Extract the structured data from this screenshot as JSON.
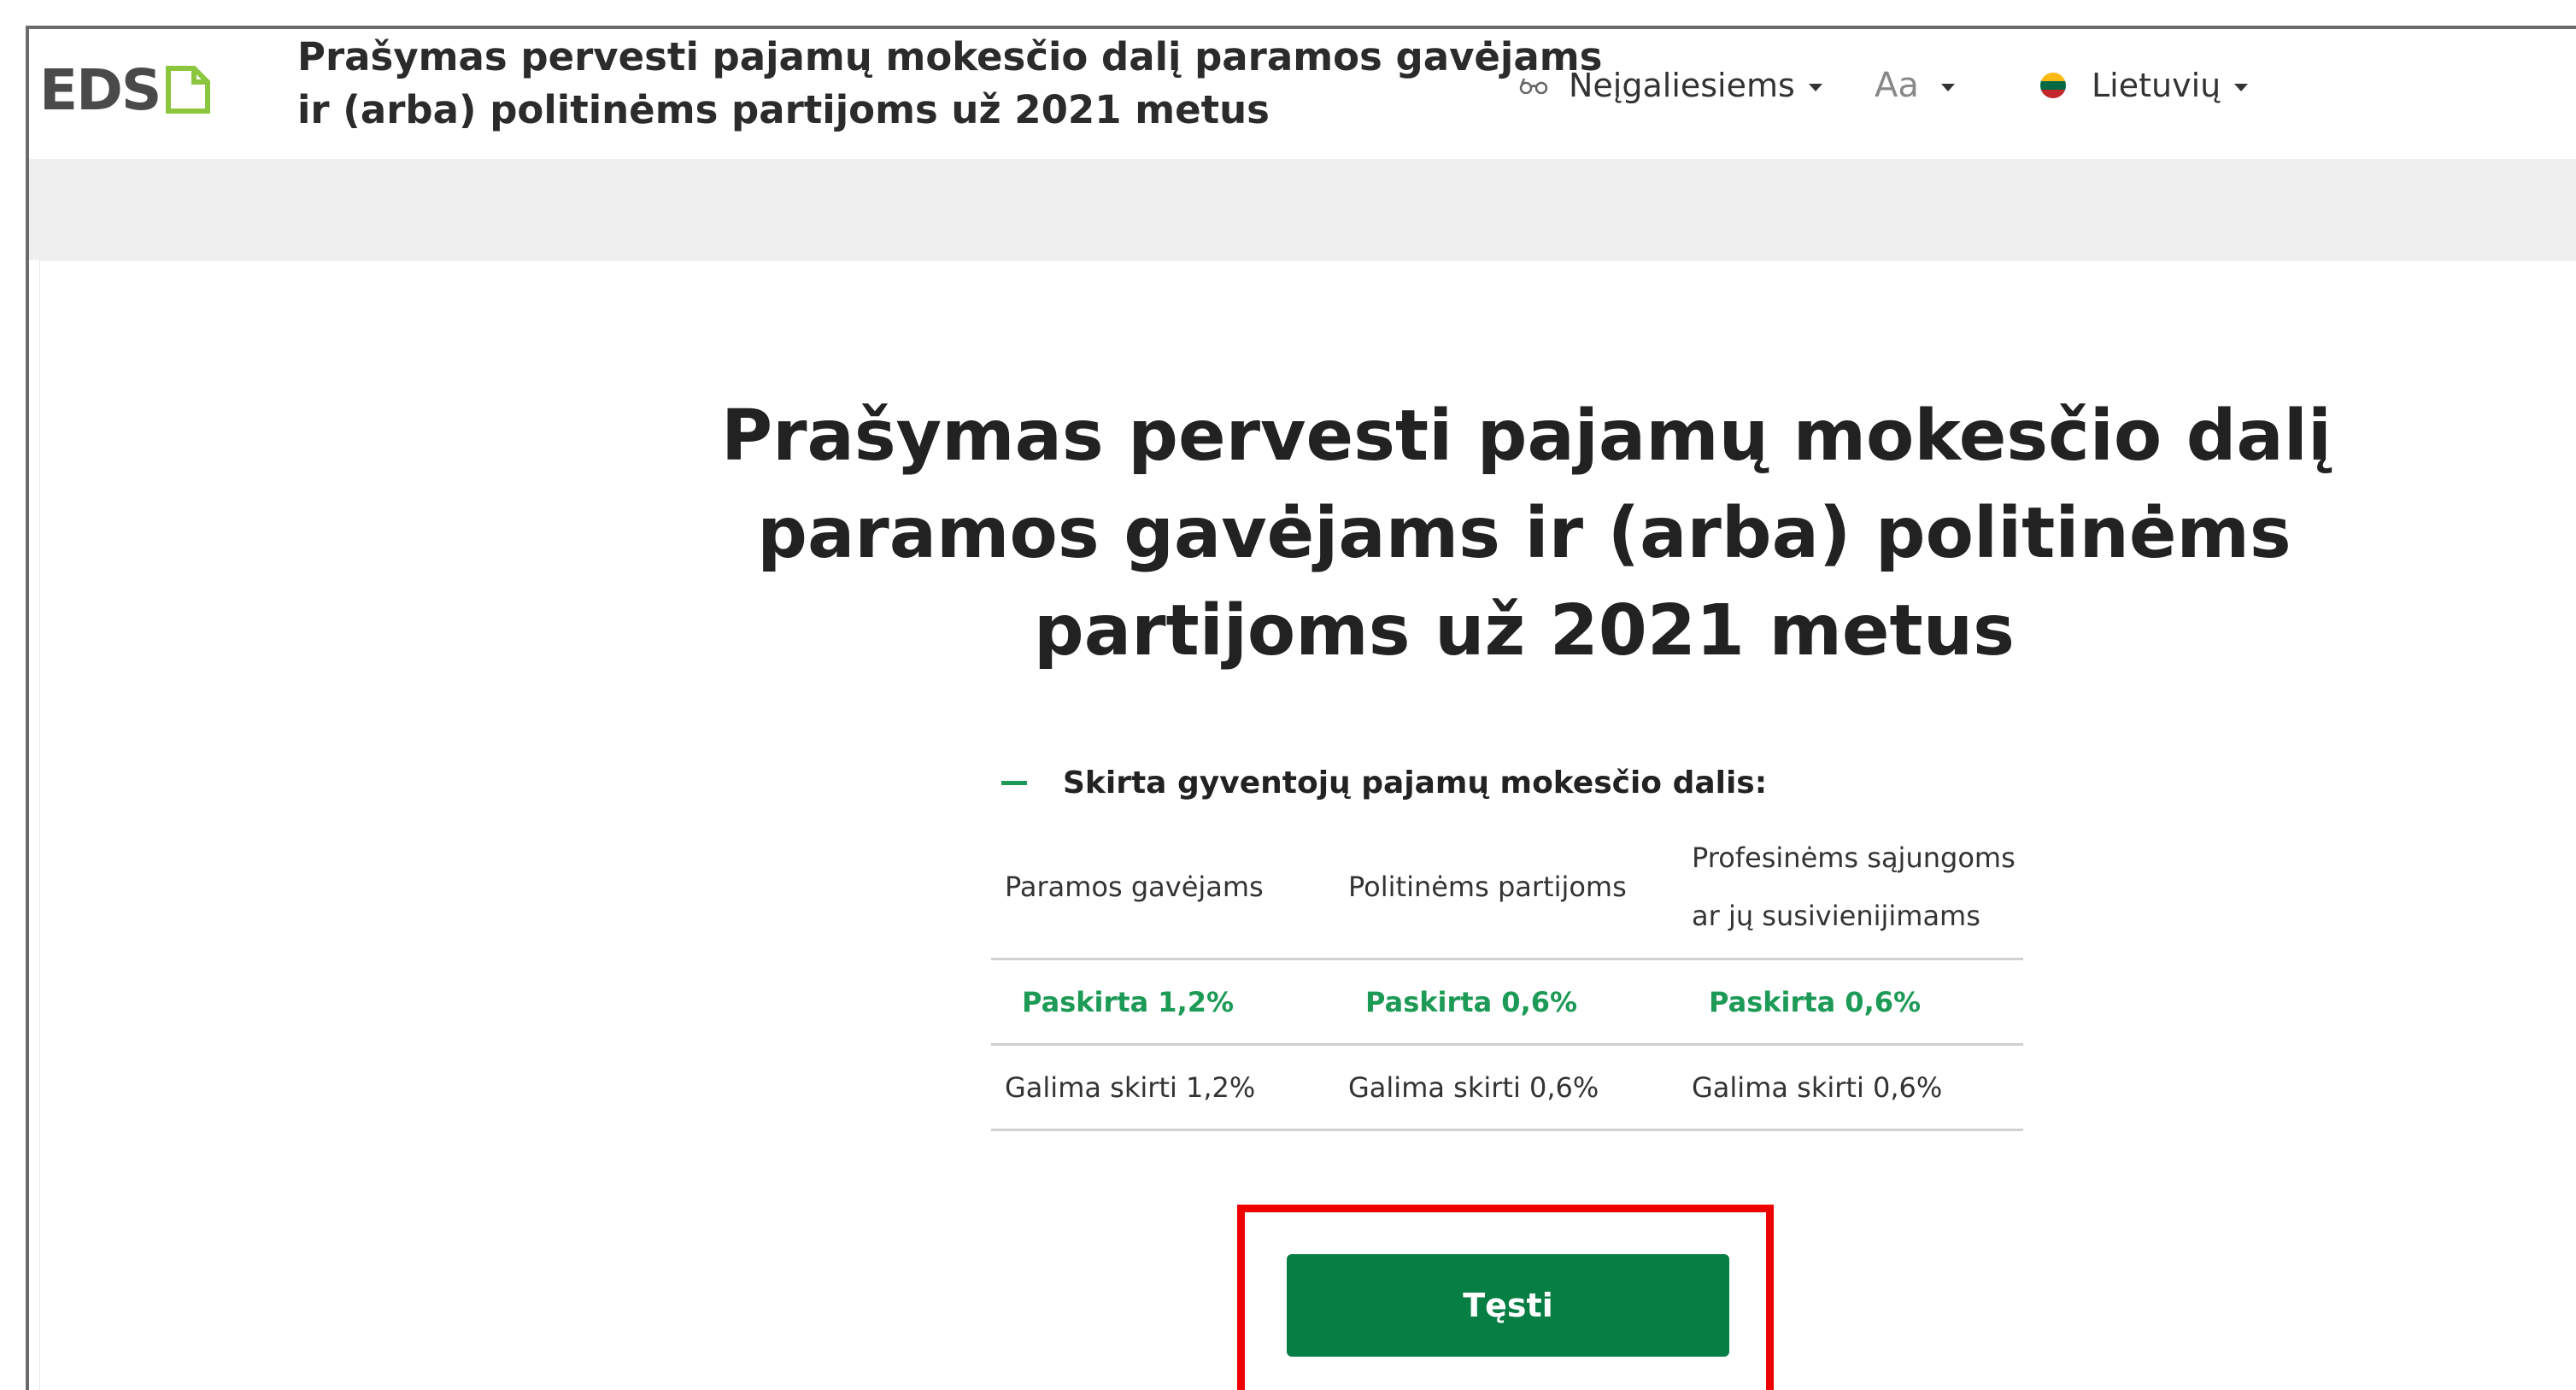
{
  "header": {
    "logo_text": "EDS",
    "title_lines": [
      "Prašymas pervesti pajamų mokesčio dalį paramos gavėjams",
      "ir (arba) politinėms partijoms už 2021 metus"
    ],
    "accessibility_label": "Neįgaliesiems",
    "font_size_label": "Aa",
    "language_label": "Lietuvių"
  },
  "main": {
    "title_lines": [
      "Prašymas pervesti pajamų mokesčio dalį",
      "paramos gavėjams ir (arba) politinėms",
      "partijoms už 2021 metus"
    ],
    "section_title": "Skirta gyventojų pajamų mokesčio dalis:",
    "table": {
      "headers": [
        [
          "Paramos gavėjams"
        ],
        [
          "Politinėms partijoms"
        ],
        [
          "Profesinėms sąjungoms",
          "ar jų susivienijimams"
        ]
      ],
      "allocated": [
        "Paskirta 1,2%",
        "Paskirta 0,6%",
        "Paskirta 0,6%"
      ],
      "available": [
        "Galima skirti 1,2%",
        "Galima skirti 0,6%",
        "Galima skirti 0,6%"
      ]
    },
    "continue_label": "Tęsti"
  },
  "colors": {
    "accent_green": "#1c9a56",
    "button_green": "#077e44",
    "highlight_red": "#ee0000",
    "band_grey": "#efefef"
  }
}
